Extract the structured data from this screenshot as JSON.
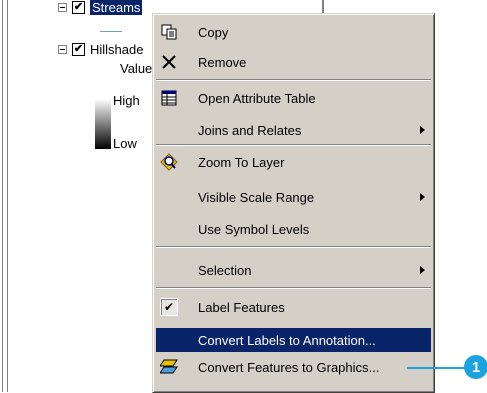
{
  "toc": {
    "layer1": {
      "name": "Streams",
      "checked_mark": "✔"
    },
    "layer2": {
      "name": "Hillshade",
      "checked_mark": "✔",
      "value_label": "Value",
      "high_label": "High",
      "low_label": "Low"
    }
  },
  "menu": {
    "items": [
      {
        "label": "Copy",
        "icon": "copy-icon"
      },
      {
        "label": "Remove",
        "icon": "remove-icon"
      },
      {
        "label": "Open Attribute Table",
        "icon": "table-icon"
      },
      {
        "label": "Joins and Relates",
        "submenu": true
      },
      {
        "label": "Zoom To Layer",
        "icon": "zoom-to-layer-icon"
      },
      {
        "label": "Visible Scale Range",
        "submenu": true
      },
      {
        "label": "Use Symbol Levels"
      },
      {
        "label": "Selection",
        "submenu": true
      },
      {
        "label": "Label Features",
        "checked": true,
        "check_mark": "✔"
      },
      {
        "label": "Convert Labels to Annotation...",
        "highlighted": true
      },
      {
        "label": "Convert Features to Graphics...",
        "icon": "convert-to-graphics-icon"
      }
    ]
  },
  "callout": {
    "number": "1"
  },
  "colors": {
    "highlight": "#0a246a",
    "menu_bg": "#d4d0c8",
    "callout": "#1aa3e0"
  }
}
